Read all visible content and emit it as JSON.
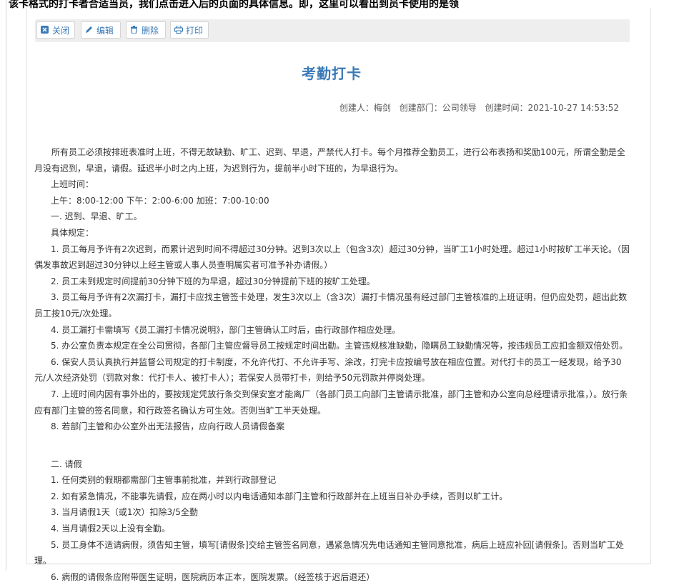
{
  "top_strip_text": "该卡格式的打卡者合适当员，我们点击进入后的页面的具体信息。即，这里可以看出到员卡使用的是领",
  "toolbar": {
    "close_label": "关闭",
    "edit_label": "编辑",
    "delete_label": "删除",
    "print_label": "打印",
    "icons": [
      "close-icon",
      "edit-icon",
      "delete-icon",
      "print-icon"
    ]
  },
  "document": {
    "title": "考勤打卡",
    "meta": {
      "creator": "创建人：梅剑",
      "department": "创建部门：公司领导",
      "created_time": "创建时间：2021-10-27 14:53:52"
    },
    "paragraphs": [
      "所有员工必须按排班表准时上班，不得无故缺勤、旷工、迟到、早退，严禁代人打卡。每个月推荐全勤员工，进行公布表扬和奖励100元，所谓全勤是全月没有迟到，早退，请假。延迟半小时之内上班，为迟到行为，提前半小时下班的，为早退行为。",
      "上班时间：",
      "上午：8:00-12:00 下午：2:00-6:00 加班：7:00-10:00",
      "一. 迟到、早退、旷工。",
      "具体规定：",
      "1. 员工每月予许有2次迟到，而累计迟到时间不得超过30分钟。迟到3次以上（包含3次）超过30分钟，当旷工1小时处理。超过1小时按旷工半天论。（因偶发事故迟到超过30分钟以上经主管或人事人员查明属实者可准予补办请假。）",
      "2. 员工未到规定时间提前30分钟下班的为早退，超过30分钟提前下班的按旷工处理。",
      "3. 员工每月予许有2次漏打卡，漏打卡应找主管签卡处理，发生3次以上（含3次）漏打卡情况虽有经过部门主管核准的上班证明，但仍应处罚，超出此数员工按10元/次处理。",
      "4. 员工漏打卡需填写《员工漏打卡情况说明》，部门主管确认工时后，由行政部作相应处理。",
      "5. 办公室负责本规定在全公司贯彻，各部门主管应督导员工按规定时间出勤。主管违规核准缺勤，隐瞒员工缺勤情况等，按违规员工应扣金额双倍处罚。",
      "6. 保安人员认真执行并监督公司规定的打卡制度，不允许代打、不允许手写、涂改，打完卡应按编号放在相应位置。对代打卡的员工一经发现，给予30元/人次经济处罚（罚款对象：代打卡人、被打卡人）；若保安人员带打卡，则给予50元罚款并停岗处理。",
      "7. 上班时间内因有事外出的，要按规定凭放行条交到保安室才能离厂（各部门员工向部门主管请示批准，部门主管和办公室向总经理请示批准，）。放行条应有部门主管的签名同意，和行政签名确认方可生效。否则当旷工半天处理。",
      "8. 若部门主管和办公室外出无法报告，应向行政人员请假备案",
      "二. 请假",
      "1. 任何类别的假期都需部门主管事前批准，并到行政部登记",
      "2. 如有紧急情况，不能事先请假，应在两小时以内电话通知本部门主管和行政部并在上班当日补办手续，否则以旷工计。",
      "3. 当月请假1天（或1次）扣除3/5全勤",
      "4. 当月请假2天以上没有全勤。",
      "5. 员工身体不适请病假，须告知主管，填写[请假条]交给主管签名同意，遇紧急情况先电话通知主管同意批准，病后上班应补回[请假条]。否则当旷工处理。",
      "6. 病假的请假条应附带医生证明，医院病历本正本，医院发票。（经签核于迟后退还）"
    ]
  }
}
